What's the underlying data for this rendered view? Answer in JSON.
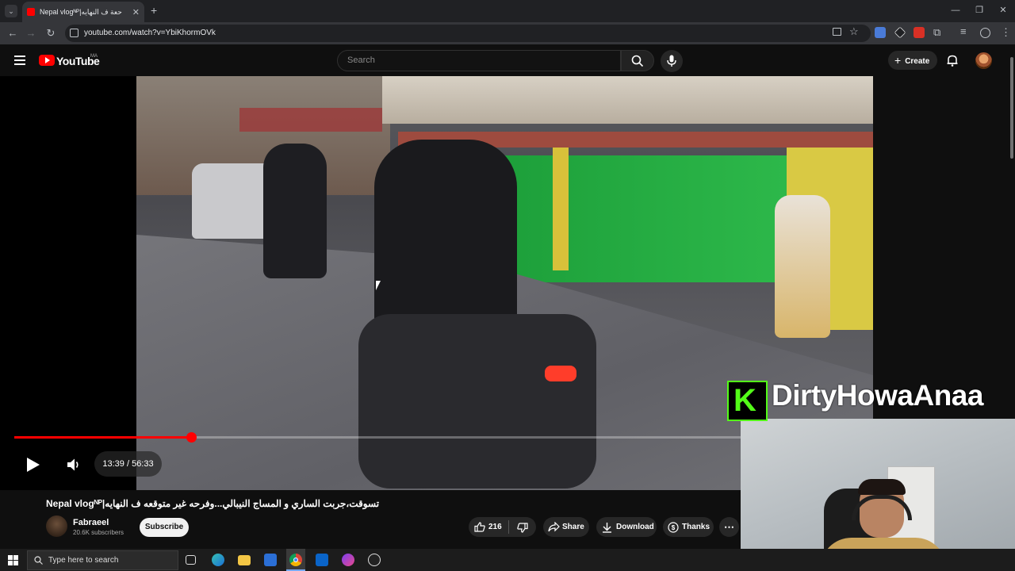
{
  "browser": {
    "tab_title": "Nepal vlogᴺᴾ|حعة ف النهايه",
    "url": "youtube.com/watch?v=YbiKhormOVk"
  },
  "youtube": {
    "logo_text": "YouTube",
    "region": "MA",
    "search_placeholder": "Search",
    "create_label": "Create"
  },
  "player": {
    "progress_fraction": 0.2435,
    "time_text": "13:39 / 56:33"
  },
  "video": {
    "title": "Nepal vlogᴺᴾ|تسوقت،جربت الساري و المساج النيبالي...وفرحه غير متوقعه ف النهايه",
    "channel_name": "Fabraeel",
    "subscribers": "20.6K subscribers",
    "subscribe_label": "Subscribe",
    "likes": "216",
    "share_label": "Share",
    "download_label": "Download",
    "thanks_label": "Thanks"
  },
  "overlay": {
    "logo_letter": "K",
    "streamer_name": "DirtyHowaAnaa"
  },
  "taskbar": {
    "search_placeholder": "Type here to search"
  },
  "colors": {
    "brand_red": "#ff0000",
    "kick_green": "#53fc18"
  }
}
